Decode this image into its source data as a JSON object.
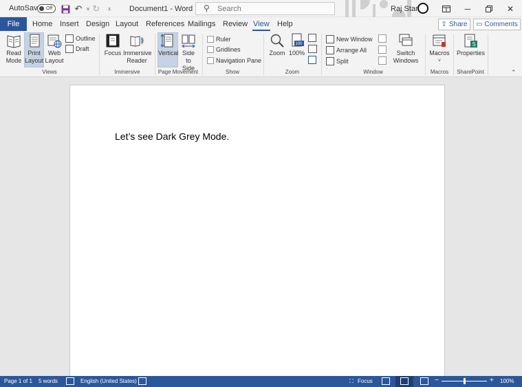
{
  "titlebar": {
    "autosave_label": "AutoSave",
    "autosave_state": "Off",
    "document_title": "Document1 - Word",
    "search_placeholder": "Search",
    "user_name": "Raj Stark"
  },
  "tabs": {
    "file": "File",
    "items": [
      "Home",
      "Insert",
      "Design",
      "Layout",
      "References",
      "Mailings",
      "Review",
      "View",
      "Help"
    ],
    "active": "View",
    "share_label": "Share",
    "comments_label": "Comments"
  },
  "ribbon": {
    "views": {
      "group_label": "Views",
      "read_mode": [
        "Read",
        "Mode"
      ],
      "print_layout": [
        "Print",
        "Layout"
      ],
      "web_layout": [
        "Web",
        "Layout"
      ],
      "outline": "Outline",
      "draft": "Draft"
    },
    "immersive": {
      "group_label": "Immersive",
      "focus": "Focus",
      "immersive_reader": [
        "Immersive",
        "Reader"
      ]
    },
    "page_movement": {
      "group_label": "Page Movement",
      "vertical": "Vertical",
      "side_to_side": [
        "Side",
        "to Side"
      ]
    },
    "show": {
      "group_label": "Show",
      "ruler": "Ruler",
      "gridlines": "Gridlines",
      "navigation_pane": "Navigation Pane"
    },
    "zoom": {
      "group_label": "Zoom",
      "zoom": "Zoom",
      "zoom_100": "100%",
      "zoom_badge": "100"
    },
    "window": {
      "group_label": "Window",
      "new_window": "New Window",
      "arrange_all": "Arrange All",
      "split": "Split",
      "switch_windows": [
        "Switch",
        "Windows"
      ]
    },
    "macros": {
      "group_label": "Macros",
      "macros": "Macros"
    },
    "sharepoint": {
      "group_label": "SharePoint",
      "properties": "Properties"
    }
  },
  "document": {
    "body_text": "Let’s see Dark Grey Mode."
  },
  "statusbar": {
    "page": "Page 1 of 1",
    "words": "5 words",
    "language": "English (United States)",
    "focus": "Focus",
    "zoom_level": "100%"
  },
  "colors": {
    "accent": "#2b579a",
    "ribbon_bg": "#f3f3f3",
    "canvas_bg": "#e6e6e6"
  }
}
